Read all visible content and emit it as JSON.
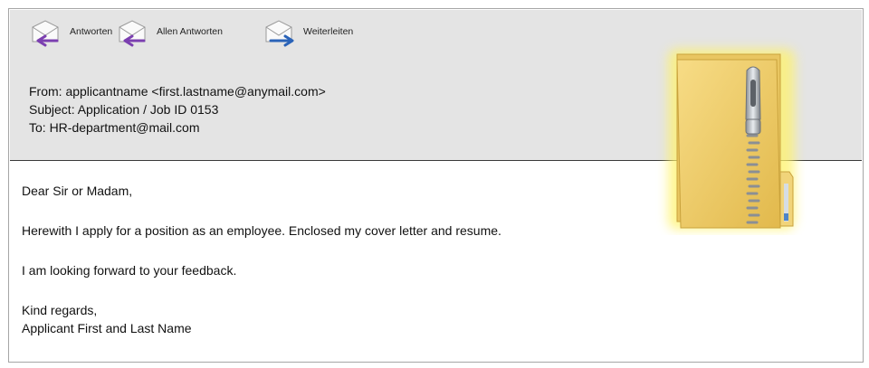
{
  "toolbar": {
    "reply_label": "Antworten",
    "reply_all_label": "Allen Antworten",
    "forward_label": "Weiterleiten"
  },
  "header": {
    "from": "From: applicantname <first.lastname@anymail.com>",
    "subject": "Subject: Application / Job ID 0153",
    "to": "To: HR-department@mail.com"
  },
  "message": {
    "salutation": "Dear Sir or Madam,",
    "paragraph_1": "Herewith I apply for a position as an employee. Enclosed my cover letter and resume.",
    "paragraph_2": " I am looking forward to your feedback.",
    "closing": "Kind regards,",
    "signature": "Applicant First and Last Name"
  },
  "attachment": {
    "icon": "zip-folder-icon"
  },
  "colors": {
    "header_bg": "#e4e4e4",
    "reply_arrow": "#7b3fb0",
    "forward_arrow": "#2a63b8",
    "folder": "#f0cf6a"
  }
}
